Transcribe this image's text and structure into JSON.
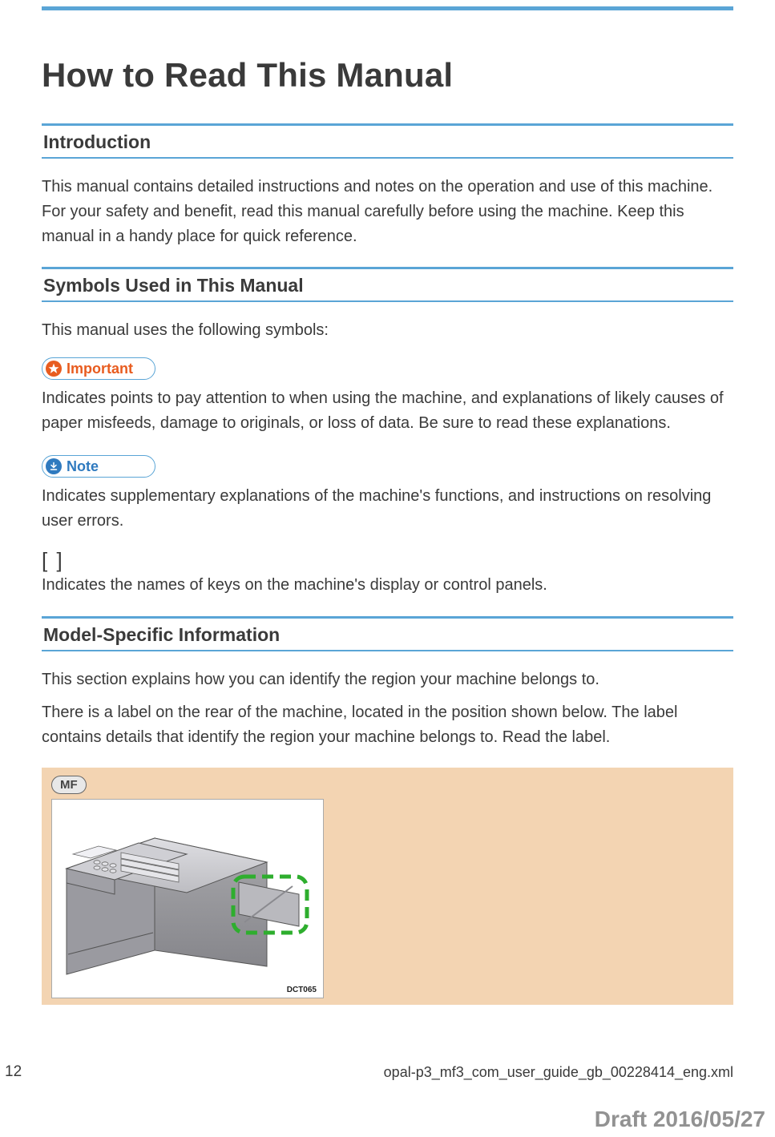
{
  "page": {
    "title": "How to Read This Manual",
    "number": "12",
    "footer_filename": "opal-p3_mf3_com_user_guide_gb_00228414_eng.xml",
    "draft_stamp": "Draft 2016/05/27"
  },
  "sections": {
    "introduction": {
      "heading": "Introduction",
      "body": "This manual contains detailed instructions and notes on the operation and use of this machine. For your safety and benefit, read this manual carefully before using the machine. Keep this manual in a handy place for quick reference."
    },
    "symbols": {
      "heading": "Symbols Used in This Manual",
      "intro": "This manual uses the following symbols:",
      "important": {
        "label": "Important",
        "desc": "Indicates points to pay attention to when using the machine, and explanations of likely causes of paper misfeeds, damage to originals, or loss of data. Be sure to read these explanations."
      },
      "note": {
        "label": "Note",
        "desc": "Indicates supplementary explanations of the machine's functions, and instructions on resolving user errors."
      },
      "bracket": {
        "symbol": "[ ]",
        "desc": "Indicates the names of keys on the machine's display or control panels."
      }
    },
    "model": {
      "heading": "Model-Specific Information",
      "p1": "This section explains how you can identify the region your machine belongs to.",
      "p2": "There is a label on the rear of the machine, located in the position shown below. The label contains details that identify the region your machine belongs to. Read the label.",
      "figure": {
        "chip": "MF",
        "code": "DCT065"
      }
    }
  }
}
